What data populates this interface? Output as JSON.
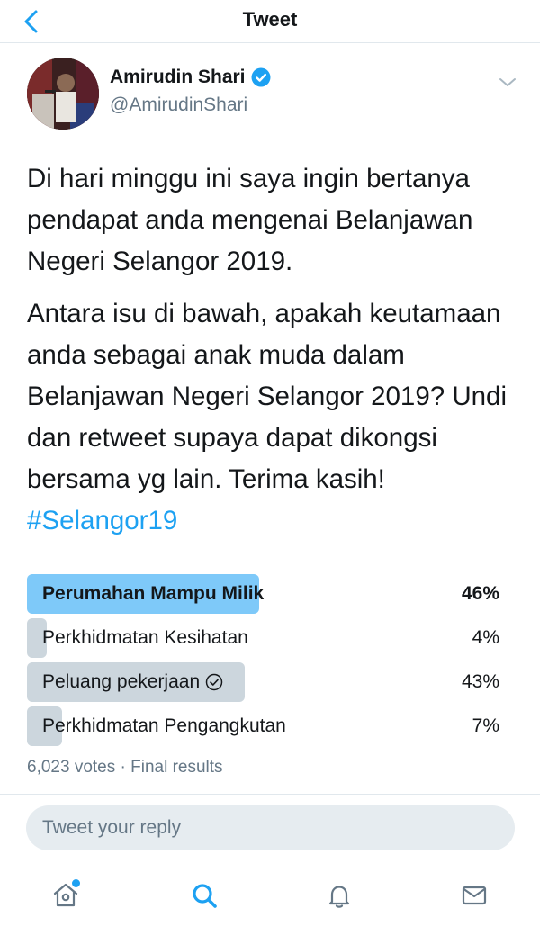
{
  "header": {
    "title": "Tweet"
  },
  "author": {
    "name": "Amirudin Shari",
    "handle": "@AmirudinShari",
    "verified": true
  },
  "tweet": {
    "paragraphs": [
      "Di hari minggu ini saya ingin bertanya pendapat anda mengenai Belanjawan Negeri Selangor 2019.",
      "Antara isu di bawah, apakah keutamaan anda sebagai anak muda dalam Belanjawan Negeri Selangor 2019? Undi dan retweet supaya dapat dikongsi bersama yg lain. Terima kasih!"
    ],
    "hashtag": "#Selangor19"
  },
  "poll": {
    "options": [
      {
        "label": "Perumahan Mampu Milik",
        "percent_text": "46%",
        "percent": 46,
        "winner": true,
        "voted": false
      },
      {
        "label": "Perkhidmatan Kesihatan",
        "percent_text": "4%",
        "percent": 4,
        "winner": false,
        "voted": false
      },
      {
        "label": "Peluang pekerjaan",
        "percent_text": "43%",
        "percent": 43,
        "winner": false,
        "voted": true
      },
      {
        "label": "Perkhidmatan Pengangkutan",
        "percent_text": "7%",
        "percent": 7,
        "winner": false,
        "voted": false
      }
    ],
    "meta": "6,023 votes · Final results"
  },
  "reply": {
    "placeholder": "Tweet your reply"
  },
  "tabs": [
    {
      "name": "home",
      "icon": "home-icon",
      "notification_dot": true
    },
    {
      "name": "search",
      "icon": "search-icon",
      "active": true
    },
    {
      "name": "notifications",
      "icon": "bell-icon"
    },
    {
      "name": "messages",
      "icon": "mail-icon"
    }
  ],
  "colors": {
    "accent": "#1da1f2",
    "poll_winner": "#7ec9f9",
    "poll_bar": "#ccd6dd",
    "muted": "#657786"
  }
}
